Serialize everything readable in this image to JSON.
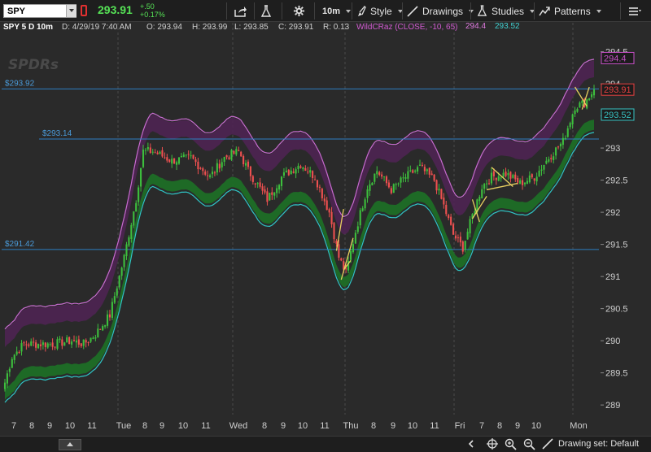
{
  "toolbar": {
    "symbol": "SPY",
    "last_price": "293.91",
    "change_abs": "+.50",
    "change_pct": "+0.17%",
    "timeframe": "10m",
    "style_label": "Style",
    "drawings_label": "Drawings",
    "studies_label": "Studies",
    "patterns_label": "Patterns",
    "price_color": "#56e356"
  },
  "infobar": {
    "symbol_period": "SPY 5 D 10m",
    "date": "D: 4/29/19 7:40 AM",
    "open": "O: 293.94",
    "high": "H: 293.99",
    "low": "L: 293.85",
    "close": "C: 293.91",
    "range": "R: 0.13",
    "study": "WildCRaz (CLOSE, -10, 65)",
    "study_upper": "294.4",
    "study_lower": "293.52"
  },
  "chart_data": {
    "type": "candlestick",
    "yaxis": {
      "min": 288.85,
      "max": 294.95,
      "ticks": [
        294.5,
        294,
        293.5,
        293,
        292.5,
        292,
        291.5,
        291,
        290.5,
        290,
        289.5,
        289
      ],
      "tick_labels": [
        "294.5",
        "294",
        "",
        "293",
        "292.5",
        "292",
        "291.5",
        "291",
        "290.5",
        "290",
        "289.5",
        "289"
      ]
    },
    "xaxis": {
      "labels": [
        "7",
        "8",
        "9",
        "10",
        "11",
        "Tue",
        "8",
        "9",
        "10",
        "11",
        "Wed",
        "8",
        "9",
        "10",
        "11",
        "Thu",
        "8",
        "9",
        "10",
        "11",
        "Fri",
        "7",
        "8",
        "9",
        "10",
        "Mon"
      ],
      "session_breaks": [
        "Tue",
        "Wed",
        "Thu",
        "Fri",
        "Mon"
      ]
    },
    "price_levels": [
      {
        "label": "$293.92",
        "value": 293.92
      },
      {
        "label": "$293.14",
        "value": 293.14
      },
      {
        "label": "$291.42",
        "value": 291.42
      }
    ],
    "price_badges": [
      {
        "label": "294.4",
        "value": 294.4,
        "color": "#c64fc6"
      },
      {
        "label": "293.91",
        "value": 293.91,
        "color": "#e84040"
      },
      {
        "label": "293.52",
        "value": 293.52,
        "color": "#36c2c2"
      }
    ],
    "watermark": "SPDRs",
    "anchors": [
      {
        "i": 0,
        "v": 289.35
      },
      {
        "i": 3,
        "v": 289.75
      },
      {
        "i": 8,
        "v": 289.95
      },
      {
        "i": 20,
        "v": 289.95
      },
      {
        "i": 28,
        "v": 290.0
      },
      {
        "i": 33,
        "v": 289.95
      },
      {
        "i": 38,
        "v": 290.1
      },
      {
        "i": 44,
        "v": 290.4
      },
      {
        "i": 50,
        "v": 291.3
      },
      {
        "i": 55,
        "v": 292.2
      },
      {
        "i": 58,
        "v": 292.95
      },
      {
        "i": 62,
        "v": 292.95
      },
      {
        "i": 70,
        "v": 292.8
      },
      {
        "i": 78,
        "v": 292.85
      },
      {
        "i": 86,
        "v": 292.55
      },
      {
        "i": 92,
        "v": 292.85
      },
      {
        "i": 98,
        "v": 292.95
      },
      {
        "i": 102,
        "v": 292.65
      },
      {
        "i": 110,
        "v": 292.2
      },
      {
        "i": 116,
        "v": 292.55
      },
      {
        "i": 124,
        "v": 292.75
      },
      {
        "i": 130,
        "v": 292.55
      },
      {
        "i": 136,
        "v": 292.0
      },
      {
        "i": 140,
        "v": 291.3
      },
      {
        "i": 143,
        "v": 291.05
      },
      {
        "i": 147,
        "v": 291.7
      },
      {
        "i": 152,
        "v": 292.4
      },
      {
        "i": 156,
        "v": 292.65
      },
      {
        "i": 162,
        "v": 292.35
      },
      {
        "i": 168,
        "v": 292.55
      },
      {
        "i": 174,
        "v": 292.7
      },
      {
        "i": 180,
        "v": 292.5
      },
      {
        "i": 184,
        "v": 292.1
      },
      {
        "i": 188,
        "v": 291.65
      },
      {
        "i": 192,
        "v": 291.45
      },
      {
        "i": 196,
        "v": 291.95
      },
      {
        "i": 200,
        "v": 292.4
      },
      {
        "i": 204,
        "v": 292.55
      },
      {
        "i": 210,
        "v": 292.6
      },
      {
        "i": 216,
        "v": 292.45
      },
      {
        "i": 222,
        "v": 292.55
      },
      {
        "i": 228,
        "v": 292.85
      },
      {
        "i": 234,
        "v": 293.1
      },
      {
        "i": 239,
        "v": 293.65
      },
      {
        "i": 243,
        "v": 293.7
      },
      {
        "i": 247,
        "v": 293.91
      }
    ],
    "candle_count": 248,
    "bands": {
      "upper_color": "#c86bd0",
      "upper_fill": "#4e2452",
      "lower_color": "#2fc6c6",
      "lower_fill": "#1e6e26"
    },
    "candle_colors": {
      "up": "#3dbf3d",
      "down": "#ee5050"
    }
  },
  "bottombar": {
    "drawing_set": "Drawing set: Default"
  }
}
